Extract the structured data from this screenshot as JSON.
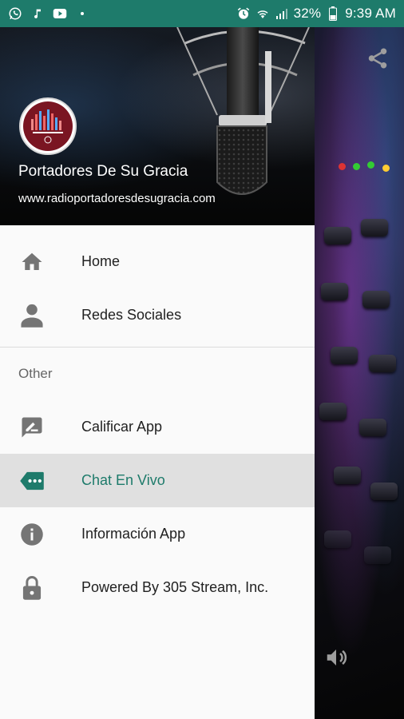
{
  "status_bar": {
    "battery": "32%",
    "time": "9:39 AM"
  },
  "header": {
    "title": "Portadores De Su Gracia",
    "url": "www.radioportadoresdesugracia.com"
  },
  "menu": {
    "primary": [
      {
        "label": "Home",
        "icon": "home-icon"
      },
      {
        "label": "Redes Sociales",
        "icon": "person-icon"
      }
    ],
    "section_label": "Other",
    "secondary": [
      {
        "label": "Calificar App",
        "icon": "rate-review-icon"
      },
      {
        "label": "Chat En Vivo",
        "icon": "chat-tag-icon",
        "active": true
      },
      {
        "label": "Información App",
        "icon": "info-icon"
      },
      {
        "label": "Powered By 305 Stream, Inc.",
        "icon": "lock-icon"
      }
    ]
  },
  "colors": {
    "accent": "#1e7b6b",
    "icon_gray": "#757575",
    "active_bg": "#e0e0e0"
  }
}
